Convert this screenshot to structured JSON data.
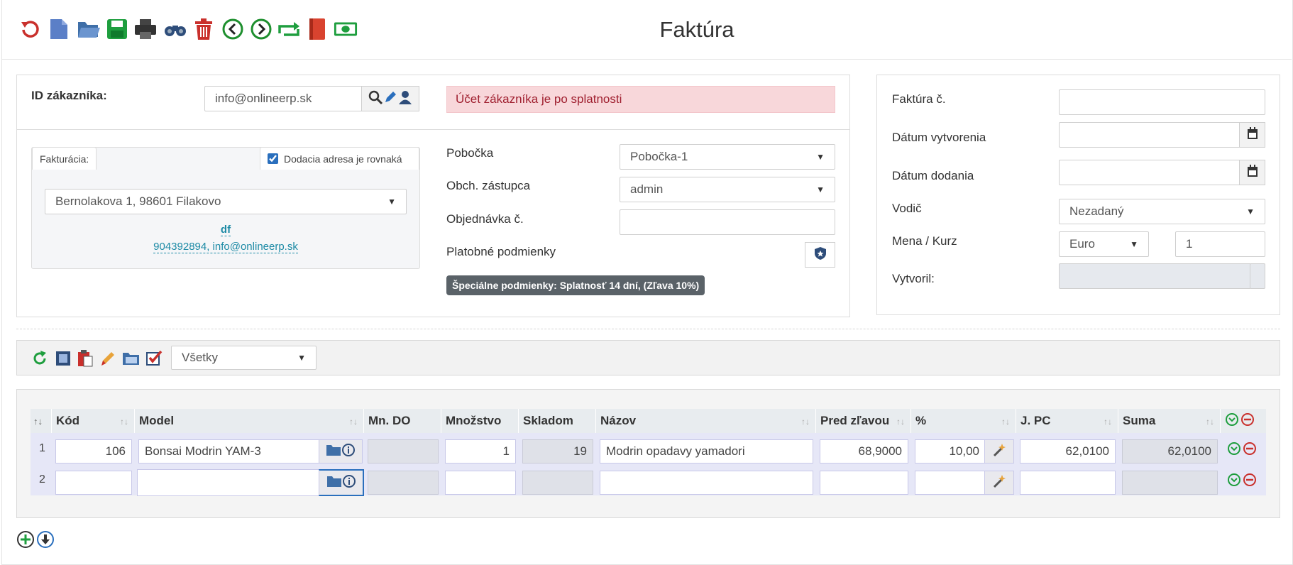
{
  "page": {
    "title": "Faktúra"
  },
  "toolbar": {
    "icons": [
      "undo-icon",
      "new-document-icon",
      "open-folder-icon",
      "save-icon",
      "print-icon",
      "search-binoculars-icon",
      "delete-trash-icon",
      "previous-icon",
      "next-icon",
      "repeat-icon",
      "book-icon",
      "money-icon"
    ]
  },
  "customer": {
    "id_label": "ID zákazníka:",
    "id_value": "info@onlineerp.sk",
    "alert": "Účet zákazníka je po splatnosti",
    "billing_tab": "Fakturácia:",
    "delivery_same_label": "Dodacia adresa je rovnaká",
    "delivery_same_checked": true,
    "address": "Bernolakova 1, 98601 Filakovo",
    "contact_name": "df",
    "contact_info": "904392894, info@onlineerp.sk"
  },
  "middle": {
    "branch_label": "Pobočka",
    "branch_value": "Pobočka-1",
    "rep_label": "Obch. zástupca",
    "rep_value": "admin",
    "order_label": "Objednávka č.",
    "order_value": "",
    "payment_label": "Platobné podmienky",
    "special_conditions": "Špeciálne podmienky: Splatnosť 14 dní, (Zľava 10%)"
  },
  "invoice": {
    "number_label": "Faktúra č.",
    "number_value": "",
    "created_label": "Dátum vytvorenia",
    "created_value": "",
    "delivered_label": "Dátum dodania",
    "delivered_value": "",
    "driver_label": "Vodič",
    "driver_value": "Nezadaný",
    "currency_label": "Mena / Kurz",
    "currency_value": "Euro",
    "rate_value": "1",
    "created_by_label": "Vytvoril:",
    "created_by_value": ""
  },
  "items_toolbar": {
    "filter_value": "Všetky"
  },
  "grid": {
    "columns": [
      "Kód",
      "Model",
      "Mn. DO",
      "Množstvo",
      "Skladom",
      "Názov",
      "Pred zľavou",
      "%",
      "J. PC",
      "Suma"
    ],
    "rows": [
      {
        "num": "1",
        "kod": "106",
        "model": "Bonsai Modrin YAM-3",
        "mn_do": "",
        "mnozstvo": "1",
        "skladom": "19",
        "nazov": "Modrin opadavy yamadori",
        "pred_zlavou": "68,9000",
        "percent": "10,00",
        "j_pc": "62,0100",
        "suma": "62,0100"
      },
      {
        "num": "2",
        "kod": "",
        "model": "",
        "mn_do": "",
        "mnozstvo": "",
        "skladom": "",
        "nazov": "",
        "pred_zlavou": "",
        "percent": "",
        "j_pc": "",
        "suma": ""
      }
    ]
  },
  "colors": {
    "accent": "#2a6fbd",
    "alert_bg": "#f8d7da",
    "row_bg": "#e6e7f7",
    "link": "#1e8ba6"
  }
}
